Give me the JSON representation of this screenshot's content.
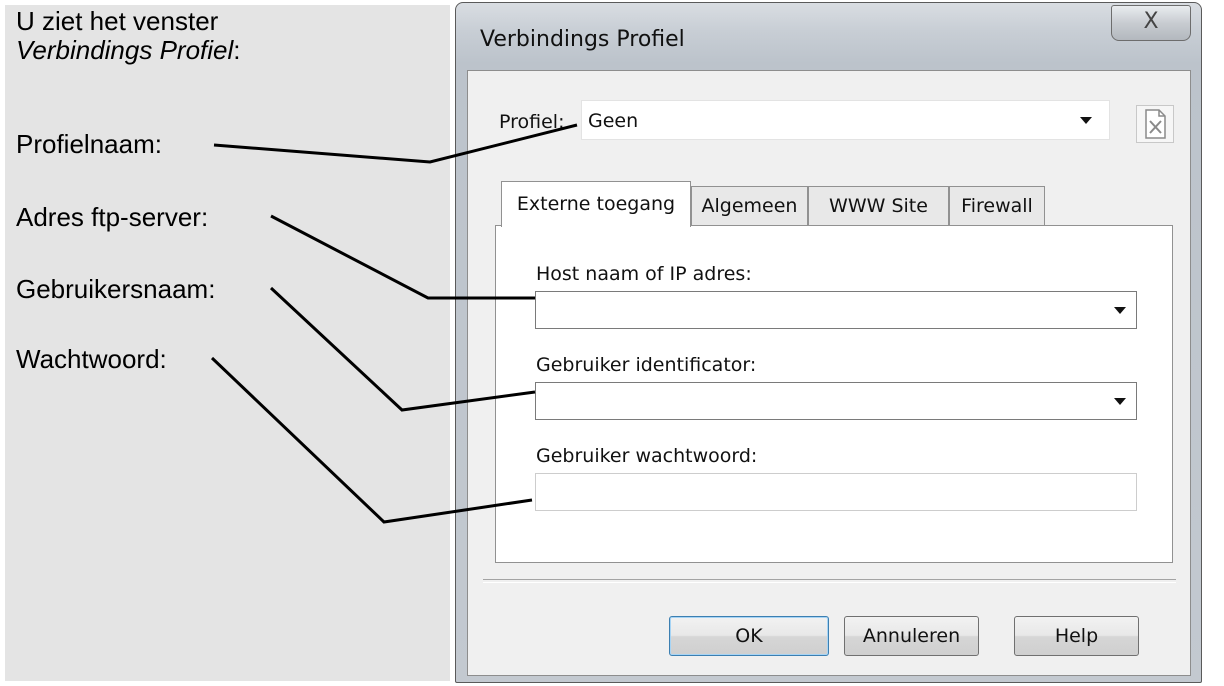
{
  "annotations": {
    "intro_line1": "U ziet het venster",
    "intro_window_name": "Verbindings Profiel",
    "intro_suffix": ":",
    "profile_name": "Profielnaam:",
    "server_address": "Adres ftp-server:",
    "username": "Gebruikersnaam:",
    "password": "Wachtwoord:"
  },
  "dialog": {
    "title": "Verbindings Profiel",
    "close_glyph": "X",
    "profile": {
      "label": "Profiel:",
      "value": "Geen"
    },
    "tabs": [
      {
        "label": "Externe toegang",
        "active": true
      },
      {
        "label": "Algemeen",
        "active": false
      },
      {
        "label": "WWW Site",
        "active": false
      },
      {
        "label": "Firewall",
        "active": false
      }
    ],
    "fields": {
      "host_label": "Host naam of IP adres:",
      "host_value": "",
      "user_label": "Gebruiker identificator:",
      "user_value": "",
      "password_label": "Gebruiker wachtwoord:",
      "password_value": ""
    },
    "buttons": {
      "ok": "OK",
      "cancel": "Annuleren",
      "help": "Help"
    }
  },
  "icons": {
    "dropdown": "chevron-down-icon",
    "delete_profile": "delete-document-icon",
    "close": "close-icon"
  },
  "colors": {
    "annotation_panel": "#e4e4e4",
    "dialog_frame": "#c8ced5",
    "client_area": "#f0f0f0",
    "focused_button_border": "#3c7fb1"
  }
}
